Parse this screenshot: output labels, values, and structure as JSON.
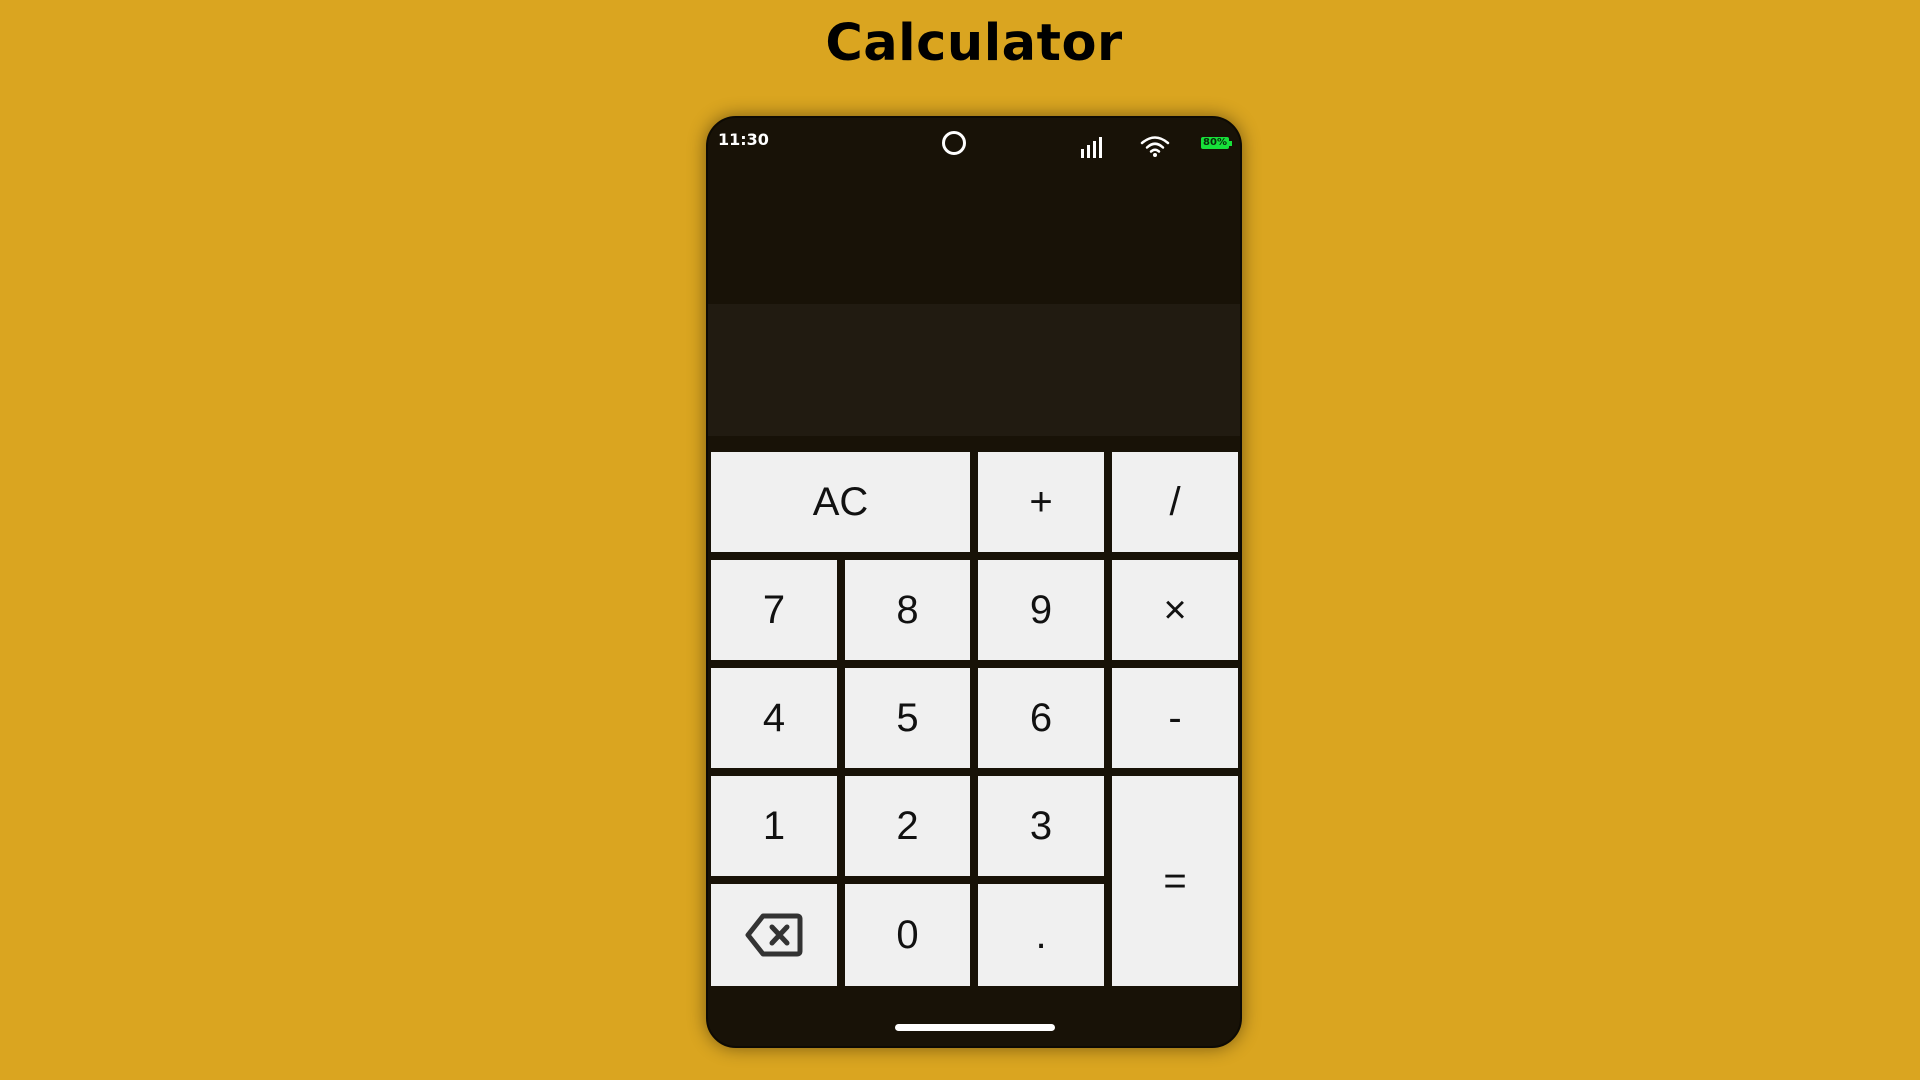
{
  "page": {
    "title": "Calculator"
  },
  "status_bar": {
    "time": "11:30",
    "battery": "80%"
  },
  "display": {
    "expression": "",
    "result": ""
  },
  "keys": {
    "ac": "AC",
    "plus": "+",
    "divide": "/",
    "seven": "7",
    "eight": "8",
    "nine": "9",
    "multiply": "×",
    "four": "4",
    "five": "5",
    "six": "6",
    "minus": "-",
    "one": "1",
    "two": "2",
    "three": "3",
    "equals": "=",
    "zero": "0",
    "decimal": "."
  },
  "colors": {
    "background": "#DAA520",
    "phone_body": "#181207",
    "result_panel": "#211b11",
    "key_face": "#f0f0f0",
    "battery": "#17e03a"
  },
  "icons": {
    "camera": "camera-icon",
    "signal": "signal-icon",
    "wifi": "wifi-icon",
    "battery": "battery-icon",
    "backspace": "backspace-icon"
  }
}
